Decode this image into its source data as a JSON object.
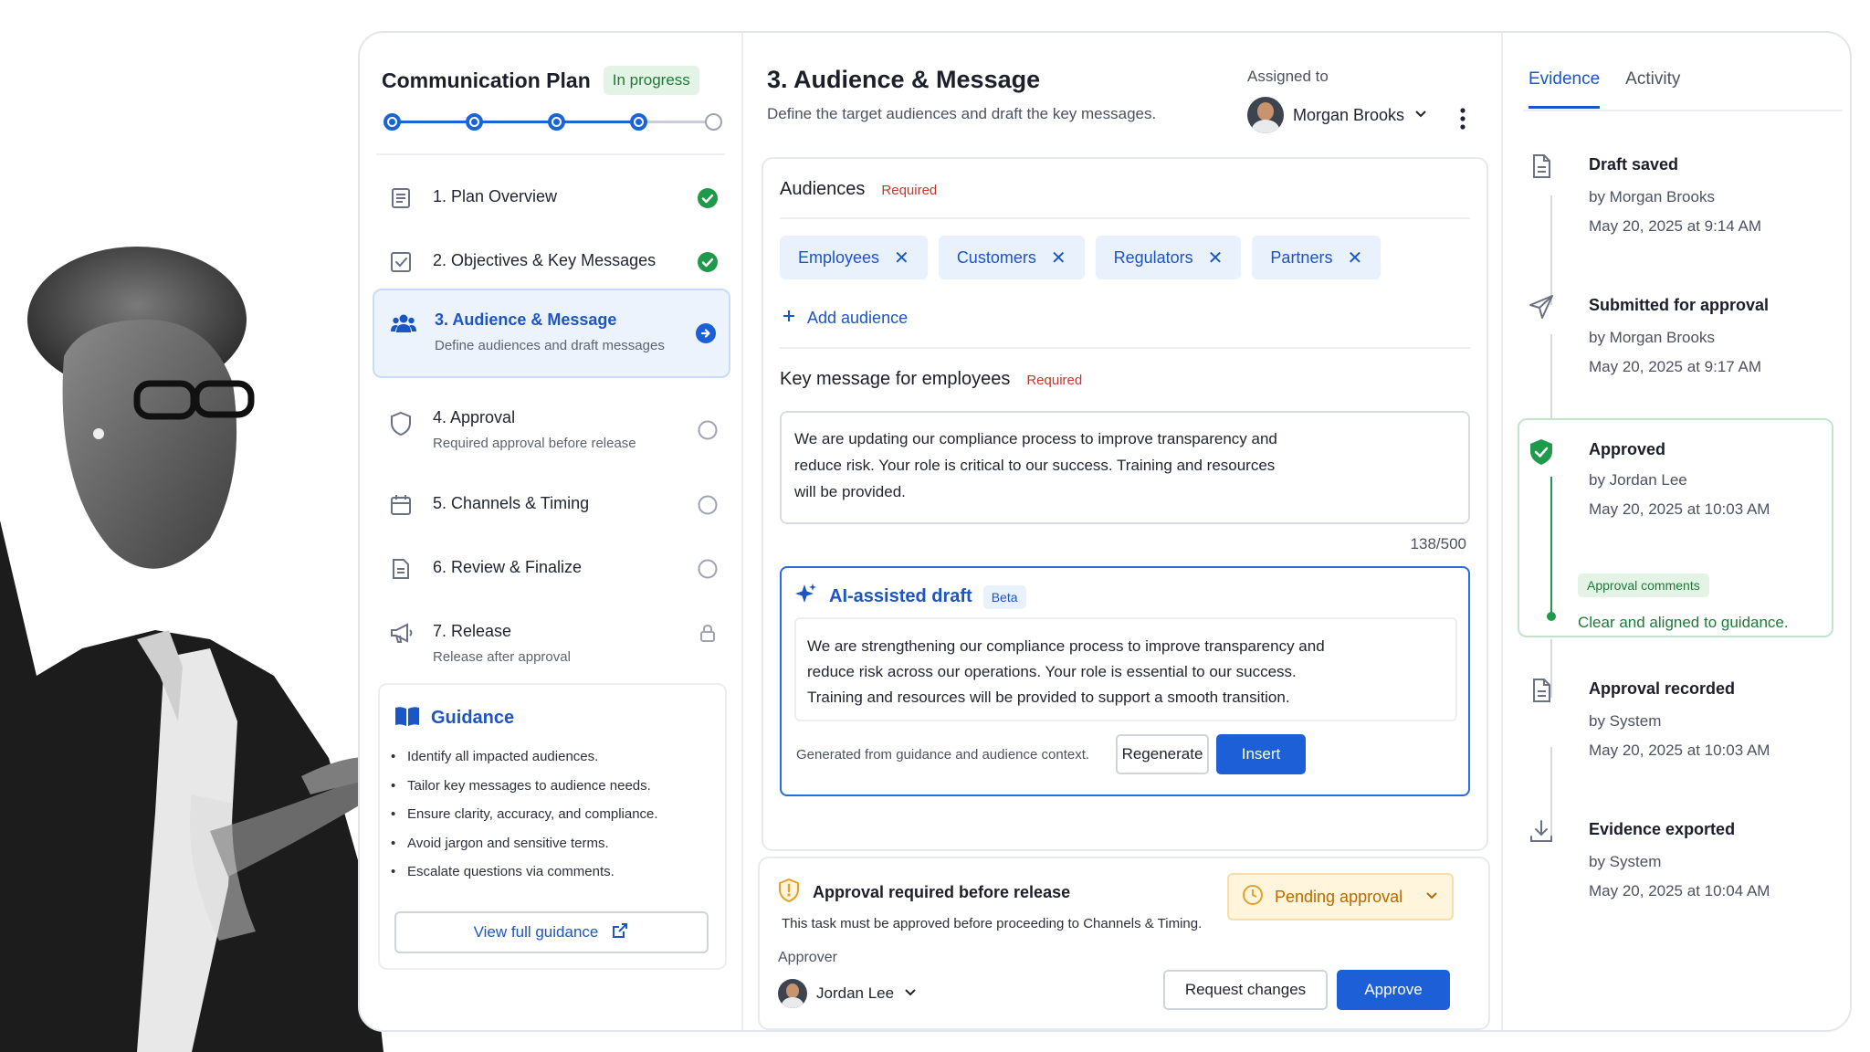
{
  "plan": {
    "title": "Communication Plan",
    "status": "In progress",
    "steps_completed": 4,
    "steps_total": 5
  },
  "nav": [
    {
      "label": "1. Plan Overview",
      "sub": "",
      "icon": "document-icon",
      "status": "complete"
    },
    {
      "label": "2. Objectives & Key Messages",
      "sub": "",
      "icon": "checkbox-icon",
      "status": "complete"
    },
    {
      "label": "3. Audience & Message",
      "sub": "Define audiences and draft messages",
      "icon": "people-icon",
      "status": "current"
    },
    {
      "label": "4. Approval",
      "sub": "Required approval before release",
      "icon": "shield-icon",
      "status": "pending"
    },
    {
      "label": "5. Channels & Timing",
      "sub": "",
      "icon": "calendar-icon",
      "status": "pending"
    },
    {
      "label": "6. Review & Finalize",
      "sub": "",
      "icon": "document-icon",
      "status": "pending"
    },
    {
      "label": "7. Release",
      "sub": "Release after approval",
      "icon": "megaphone-icon",
      "status": "locked"
    }
  ],
  "guidance": {
    "title": "Guidance",
    "items": [
      "Identify all impacted audiences.",
      "Tailor key messages to audience needs.",
      "Ensure clarity, accuracy, and compliance.",
      "Avoid jargon and sensitive terms.",
      "Escalate questions via comments."
    ],
    "button": "View full guidance"
  },
  "section": {
    "title": "3. Audience & Message",
    "subtitle": "Define the target audiences and draft the key messages.",
    "assigned_label": "Assigned to",
    "assignee": "Morgan Brooks"
  },
  "audiences": {
    "label": "Audiences",
    "required": "Required",
    "chips": [
      "Employees",
      "Customers",
      "Regulators",
      "Partners"
    ],
    "add": "Add audience"
  },
  "key_message": {
    "label": "Key message for employees",
    "required": "Required",
    "lines": [
      "We are updating our compliance process to improve transparency and",
      "reduce risk. Your role is critical to our success. Training and resources",
      "will be provided."
    ],
    "counter": "138/500"
  },
  "ai": {
    "title": "AI-assisted draft",
    "beta": "Beta",
    "lines": [
      "We are strengthening our compliance process to improve transparency and",
      "reduce risk across our operations. Your role is essential to our success.",
      "Training and resources will be provided to support a smooth transition."
    ],
    "footer": "Generated from guidance and audience context.",
    "regenerate": "Regenerate",
    "insert": "Insert"
  },
  "approval": {
    "title": "Approval required before release",
    "desc": "This task must be approved before proceeding to Channels & Timing.",
    "status": "Pending approval",
    "approver_label": "Approver",
    "approver": "Jordan Lee",
    "request_changes": "Request changes",
    "approve": "Approve"
  },
  "tabs": [
    "Evidence",
    "Activity"
  ],
  "evidence": [
    {
      "title": "Draft saved",
      "by": "by Morgan Brooks",
      "date": "May 20, 2025 at 9:14 AM",
      "icon": "document-icon"
    },
    {
      "title": "Submitted for approval",
      "by": "by Morgan Brooks",
      "date": "May 20, 2025 at 9:17 AM",
      "icon": "send-icon"
    },
    {
      "title": "Approved",
      "by": "by Jordan Lee",
      "date": "May 20, 2025 at 10:03 AM",
      "icon": "shield-check-icon",
      "comment_label": "Approval comments",
      "comment": "Clear and aligned to guidance."
    },
    {
      "title": "Approval recorded",
      "by": "by System",
      "date": "May 20, 2025 at 10:03 AM",
      "icon": "document-icon"
    },
    {
      "title": "Evidence exported",
      "by": "by System",
      "date": "May 20, 2025 at 10:04 AM",
      "icon": "download-icon"
    }
  ],
  "colors": {
    "accent": "#1c5fd6",
    "success": "#1e9a4a",
    "warning": "#b86a00",
    "required": "#c0392b"
  }
}
